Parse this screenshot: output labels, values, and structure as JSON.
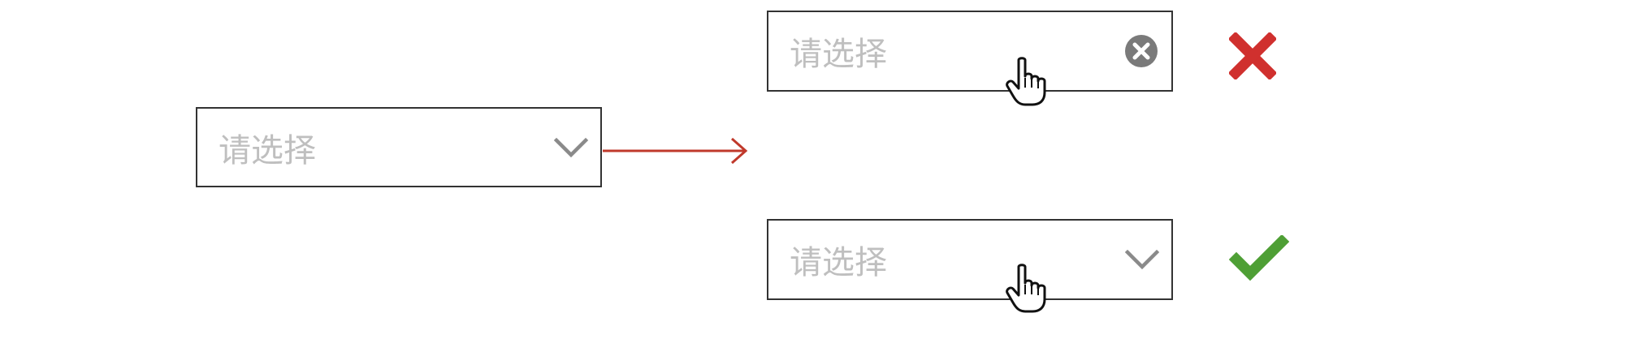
{
  "selects": [
    {
      "name": "select-default",
      "placeholder": "请选择",
      "suffix_icon": "chevron-down-icon",
      "state": "default"
    },
    {
      "name": "select-hover-clear",
      "placeholder": "请选择",
      "suffix_icon": "clear-circle-icon",
      "state": "hover"
    },
    {
      "name": "select-hover-arrow",
      "placeholder": "请选择",
      "suffix_icon": "chevron-down-icon",
      "state": "hover"
    }
  ],
  "verdicts": [
    {
      "icon": "cross-icon",
      "meaning": "incorrect",
      "color": "#d0302e"
    },
    {
      "icon": "check-icon",
      "meaning": "correct",
      "color": "#4e9f35"
    }
  ],
  "colors": {
    "border": "#333333",
    "placeholder": "#bfbfbf",
    "arrow_icon": "#8a8a8a",
    "clear_icon": "#7a7a7a",
    "connector": "#c0392b"
  },
  "icons": {
    "cursor": "hand-pointer-icon",
    "connector": "arrow-right-icon"
  }
}
